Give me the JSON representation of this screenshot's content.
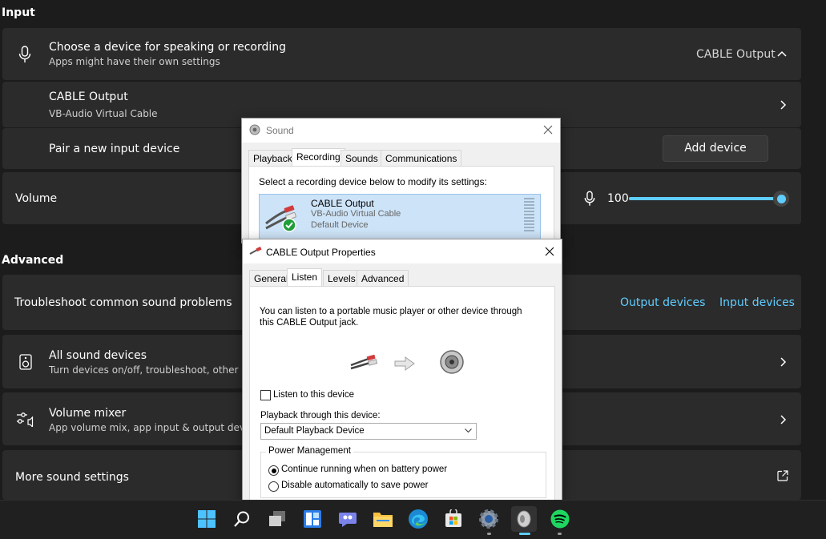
{
  "input": {
    "section_title": "Input",
    "choose_device": {
      "title": "Choose a device for speaking or recording",
      "subtitle": "Apps might have their own settings",
      "value": "CABLE Output"
    },
    "device": {
      "title": "CABLE Output",
      "subtitle": "VB-Audio Virtual Cable"
    },
    "pair": {
      "title": "Pair a new input device",
      "button": "Add device"
    },
    "volume": {
      "title": "Volume",
      "value": "100",
      "level_percent": 100
    }
  },
  "advanced": {
    "section_title": "Advanced",
    "troubleshoot": {
      "title": "Troubleshoot common sound problems",
      "link_output": "Output devices",
      "link_input": "Input devices"
    },
    "all_devices": {
      "title": "All sound devices",
      "subtitle": "Turn devices on/off, troubleshoot, other opti"
    },
    "mixer": {
      "title": "Volume mixer",
      "subtitle": "App volume mix, app input & output devices"
    },
    "more": {
      "title": "More sound settings"
    }
  },
  "sound_dialog": {
    "title": "Sound",
    "tabs": [
      "Playback",
      "Recording",
      "Sounds",
      "Communications"
    ],
    "instruction": "Select a recording device below to modify its settings:",
    "device": {
      "name": "CABLE Output",
      "desc": "VB-Audio Virtual Cable",
      "status": "Default Device"
    }
  },
  "props_dialog": {
    "title": "CABLE Output Properties",
    "tabs": [
      "General",
      "Listen",
      "Levels",
      "Advanced"
    ],
    "description": "You can listen to a portable music player or other device through this CABLE Output jack.",
    "listen_checkbox": "Listen to this device",
    "playback_label": "Playback through this device:",
    "playback_value": "Default Playback Device",
    "power_group": "Power Management",
    "radio_continue": "Continue running when on battery power",
    "radio_disable": "Disable automatically to save power"
  },
  "taskbar": {
    "icons": [
      "windows-start-icon",
      "search-icon",
      "task-view-icon",
      "widgets-icon",
      "chat-icon",
      "file-explorer-icon",
      "edge-icon",
      "store-icon",
      "settings-icon",
      "sound-app-icon",
      "spotify-icon"
    ]
  }
}
